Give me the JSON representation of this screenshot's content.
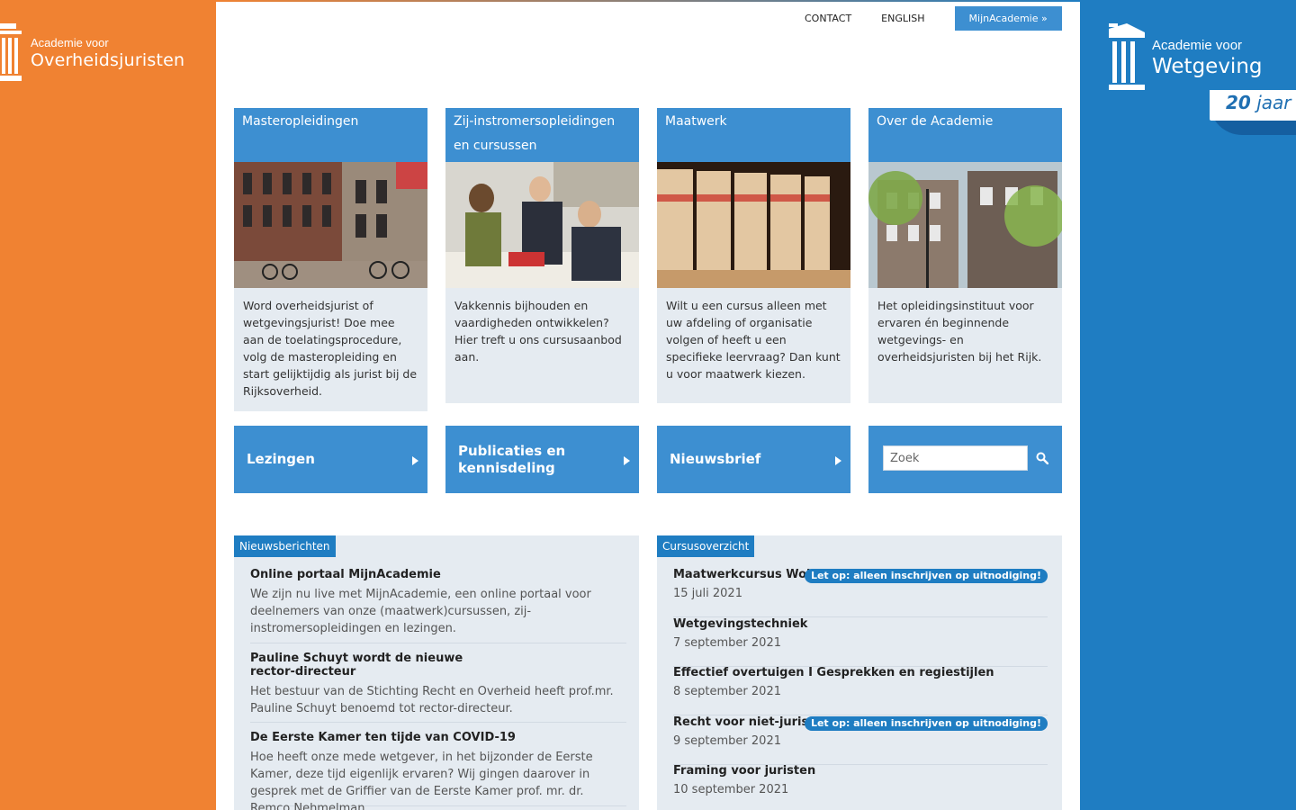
{
  "left_logo": {
    "line1": "Academie voor",
    "line2": "Overheidsjuristen"
  },
  "right_logo": {
    "line1": "Academie voor",
    "line2": "Wetgeving",
    "anniversary_number": "20",
    "anniversary_word": "jaar"
  },
  "topnav": {
    "contact": "CONTACT",
    "english": "ENGLISH",
    "mijn": "MijnAcademie »"
  },
  "colors": {
    "orange": "#f08232",
    "blue": "#1f7dc2",
    "tile_blue": "#3d8fd1",
    "panel_grey": "#e5ebf1"
  },
  "cards": [
    {
      "title": "Masteropleidingen",
      "text": "Word overheidsjurist of wetgevingsjurist! Doe mee aan de toelatingsprocedure, volg de masteropleiding en start gelijktijdig als jurist bij de Rijksoverheid.",
      "image": "historic-building-photo"
    },
    {
      "title": "Zij-instromersopleidingen en cursussen",
      "text": "Vakkennis bijhouden en vaardigheden ontwikkelen? Hier treft u ons cursusaanbod aan.",
      "image": "people-meeting-photo"
    },
    {
      "title": "Maatwerk",
      "text": "Wilt u een cursus alleen met uw afdeling of organisatie volgen of heeft u een specifieke leervraag? Dan kunt u voor maatwerk kiezen.",
      "image": "archive-books-photo"
    },
    {
      "title": "Over de Academie",
      "text": "Het opleidingsinstituut voor ervaren én beginnende wetgevings- en overheidsjuristen bij het Rijk.",
      "image": "canal-house-photo"
    }
  ],
  "tiles": [
    {
      "label": "Lezingen"
    },
    {
      "label": "Publicaties en kennisdeling"
    },
    {
      "label": "Nieuwsbrief"
    }
  ],
  "search": {
    "placeholder": "Zoek"
  },
  "news": {
    "label": "Nieuwsberichten",
    "items": [
      {
        "title": "Online portaal MijnAcademie",
        "text": "We zijn nu live met MijnAcademie, een online portaal voor deelnemers van onze (maatwerk)cursussen, zij-instromersopleidingen en lezingen."
      },
      {
        "title": "Pauline Schuyt wordt de nieuwe rector-directeur",
        "text": "Het bestuur van de Stichting Recht en Overheid heeft prof.mr. Pauline Schuyt benoemd tot rector-directeur."
      },
      {
        "title": "De Eerste Kamer ten tijde van COVID-19",
        "text": "Hoe heeft onze mede wetgever, in het bijzonder de Eerste Kamer, deze tijd eigenlijk ervaren? Wij gingen daarover in gesprek met de Griffier van de Eerste Kamer prof. mr. dr. Remco Nehmelman"
      }
    ]
  },
  "courses": {
    "label": "Cursusoverzicht",
    "items": [
      {
        "title": "Maatwerkcursus Wob",
        "date": "15 juli 2021",
        "badge": "Let op: alleen inschrijven op uitnodiging!"
      },
      {
        "title": "Wetgevingstechniek",
        "date": "7 september 2021",
        "badge": ""
      },
      {
        "title": "Effectief overtuigen I Gesprekken en regiestijlen",
        "date": "8 september 2021",
        "badge": ""
      },
      {
        "title": "Recht voor niet-juristen",
        "date": "9 september 2021",
        "badge": "Let op: alleen inschrijven op uitnodiging!"
      },
      {
        "title": "Framing voor juristen",
        "date": "10 september 2021",
        "badge": ""
      }
    ]
  }
}
